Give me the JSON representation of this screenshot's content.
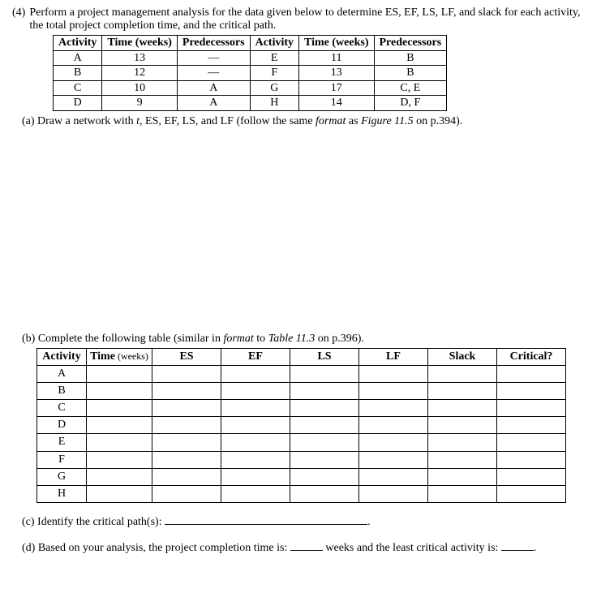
{
  "question": {
    "number": "(4)",
    "prompt": "Perform a project management analysis for the data given below to determine ES, EF, LS, LF, and slack for each activity, the total project completion time, and the critical path."
  },
  "data_table": {
    "headers": {
      "activity": "Activity",
      "time": "Time (weeks)",
      "predecessors": "Predecessors"
    },
    "left_rows": [
      {
        "activity": "A",
        "time": "13",
        "pred": "—"
      },
      {
        "activity": "B",
        "time": "12",
        "pred": "—"
      },
      {
        "activity": "C",
        "time": "10",
        "pred": "A"
      },
      {
        "activity": "D",
        "time": "9",
        "pred": "A"
      }
    ],
    "right_rows": [
      {
        "activity": "E",
        "time": "11",
        "pred": "B"
      },
      {
        "activity": "F",
        "time": "13",
        "pred": "B"
      },
      {
        "activity": "G",
        "time": "17",
        "pred": "C, E"
      },
      {
        "activity": "H",
        "time": "14",
        "pred": "D, F"
      }
    ]
  },
  "part_a": {
    "prefix": "(a) Draw a network with ",
    "italic1": "t",
    "mid": ", ES, EF, LS, and LF (follow the same ",
    "italic2": "format",
    "mid2": " as ",
    "italic3": "Figure 11.5",
    "suffix": " on p.394)."
  },
  "part_b": {
    "prefix": "(b) Complete the following table (similar in ",
    "italic1": "format",
    "mid": " to ",
    "italic2": "Table 11.3",
    "suffix": " on p.396)."
  },
  "answer_table": {
    "headers": {
      "activity": "Activity",
      "time": "Time",
      "time_unit": " (weeks)",
      "es": "ES",
      "ef": "EF",
      "ls": "LS",
      "lf": "LF",
      "slack": "Slack",
      "critical": "Critical?"
    },
    "rows": [
      "A",
      "B",
      "C",
      "D",
      "E",
      "F",
      "G",
      "H"
    ]
  },
  "part_c": {
    "text": "(c) Identify the critical path(s): ",
    "end": "."
  },
  "part_d": {
    "prefix": "(d) Based on your analysis, the project completion time is: ",
    "mid": " weeks and the least critical activity is: ",
    "end": "."
  }
}
